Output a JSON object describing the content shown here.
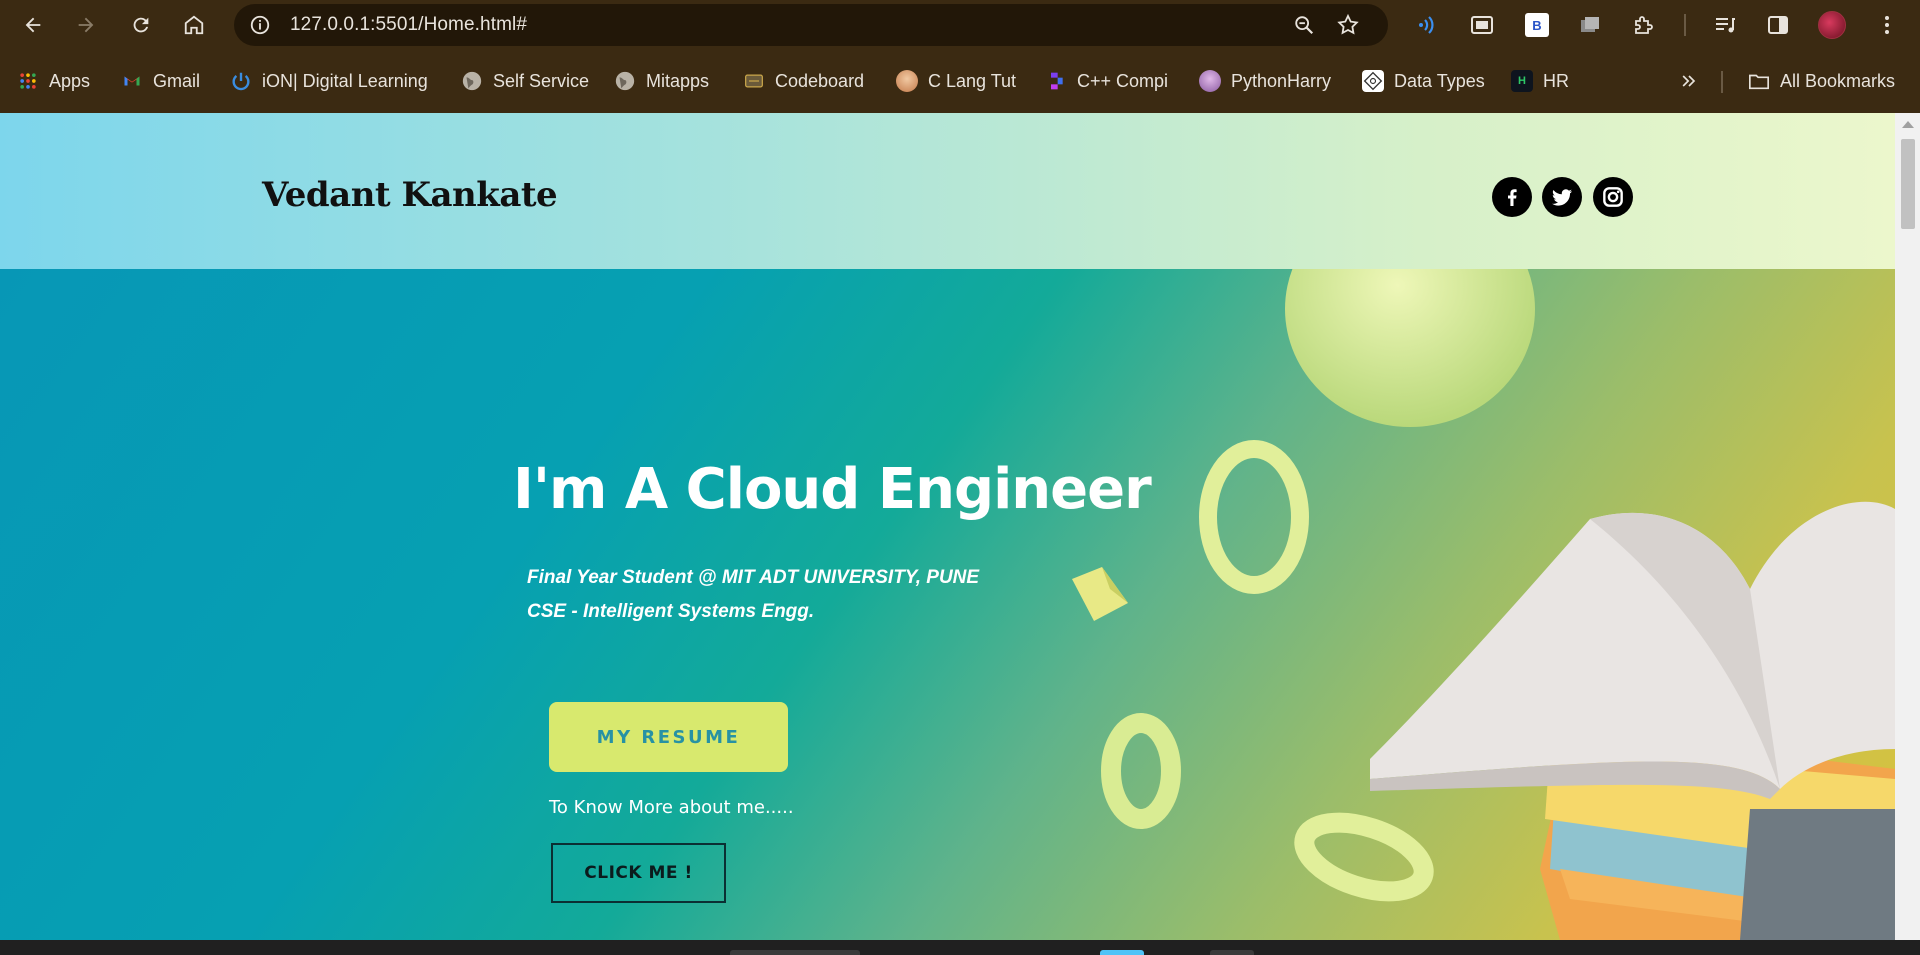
{
  "browser": {
    "url": "127.0.0.1:5501/Home.html#",
    "bookmarks": [
      {
        "label": "Apps",
        "icon": "apps-grid-icon"
      },
      {
        "label": "Gmail",
        "icon": "gmail-icon"
      },
      {
        "label": "iON| Digital Learning",
        "icon": "power-icon"
      },
      {
        "label": "Self Service",
        "icon": "globe-icon"
      },
      {
        "label": "Mitapps",
        "icon": "globe-icon"
      },
      {
        "label": "Codeboard",
        "icon": "codeboard-icon"
      },
      {
        "label": "C Lang Tut",
        "icon": "avatar-icon"
      },
      {
        "label": "C++ Compi",
        "icon": "replit-icon"
      },
      {
        "label": "PythonHarry",
        "icon": "avatar-icon"
      },
      {
        "label": "Data Types",
        "icon": "datatypes-icon"
      },
      {
        "label": "HR",
        "icon": "hackerrank-icon"
      }
    ],
    "all_bookmarks_label": "All Bookmarks",
    "extension_badge": "B"
  },
  "site": {
    "brand": "Vedant Kankate",
    "social": [
      "facebook",
      "twitter",
      "instagram"
    ]
  },
  "hero": {
    "title": "I'm A Cloud Engineer",
    "subtitle_line1": "Final Year Student @ MIT ADT UNIVERSITY, PUNE",
    "subtitle_line2": "CSE - Intelligent Systems Engg.",
    "resume_button": "MY RESUME",
    "know_more_text": "To Know More about me.....",
    "click_button": "CLICK ME !"
  },
  "colors": {
    "chrome_bg": "#3b2a12",
    "resume_button_bg": "#d8e96e",
    "resume_button_text": "#2792a4"
  }
}
